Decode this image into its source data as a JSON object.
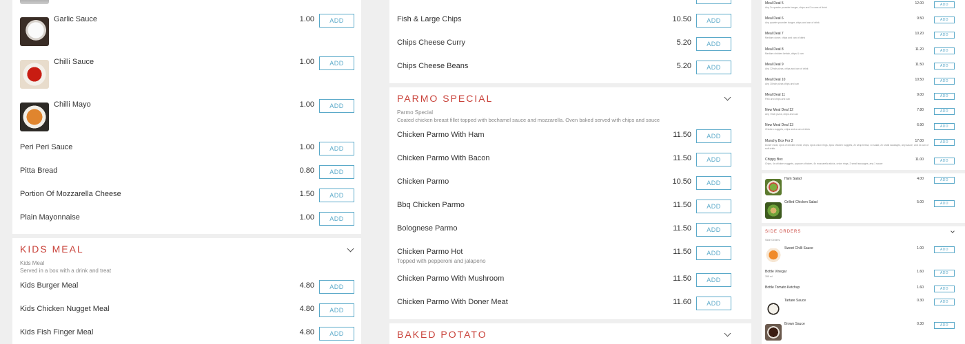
{
  "colors": {
    "accent": "#c9423a",
    "button": "#5aa9c9"
  },
  "add_label": "ADD",
  "col1": {
    "items": [
      {
        "name": "Garlic Sauce",
        "price": "1.00",
        "image": "garlic-sauce"
      },
      {
        "name": "Chilli Sauce",
        "price": "1.00",
        "image": "chilli-sauce"
      },
      {
        "name": "Chilli Mayo",
        "price": "1.00",
        "image": "chilli-mayo"
      },
      {
        "name": "Peri Peri Sauce",
        "price": "1.00"
      },
      {
        "name": "Pitta Bread",
        "price": "0.80"
      },
      {
        "name": "Portion Of Mozzarella Cheese",
        "price": "1.50"
      },
      {
        "name": "Plain Mayonnaise",
        "price": "1.00"
      }
    ],
    "kids": {
      "title": "KIDS MEAL",
      "sub_title": "Kids Meal",
      "sub_desc": "Served in a box with a drink and treat",
      "items": [
        {
          "name": "Kids Burger Meal",
          "price": "4.80"
        },
        {
          "name": "Kids Chicken Nugget Meal",
          "price": "4.80"
        },
        {
          "name": "Kids Fish Finger Meal",
          "price": "4.80"
        }
      ]
    }
  },
  "col2": {
    "items": [
      {
        "name": "Fish & Large Chips",
        "price": "10.50"
      },
      {
        "name": "Chips Cheese Curry",
        "price": "5.20"
      },
      {
        "name": "Chips Cheese Beans",
        "price": "5.20"
      }
    ],
    "parmo": {
      "title": "PARMO SPECIAL",
      "sub_title": "Parmo Special",
      "sub_desc": "Coated chicken breast fillet topped with bechamel sauce and mozzarella. Oven baked served with chips and sauce",
      "items": [
        {
          "name": "Chicken Parmo With Ham",
          "price": "11.50"
        },
        {
          "name": "Chicken Parmo With Bacon",
          "price": "11.50"
        },
        {
          "name": "Chicken Parmo",
          "price": "10.50"
        },
        {
          "name": "Bbq Chicken Parmo",
          "price": "11.50"
        },
        {
          "name": "Bolognese Parmo",
          "price": "11.50"
        },
        {
          "name": "Chicken Parmo Hot",
          "price": "11.50",
          "desc": "Topped with pepperoni and jalapeno"
        },
        {
          "name": "Chicken Parmo With Mushroom",
          "price": "11.50"
        },
        {
          "name": "Chicken Parmo With Doner Meat",
          "price": "11.60"
        }
      ]
    },
    "baked": {
      "title": "BAKED POTATO"
    }
  },
  "col3": {
    "deals": [
      {
        "name": "Meal Deal 5",
        "price": "12.00",
        "desc": "Any 2x quarter pounder burger, chips and 2x cans of drink"
      },
      {
        "name": "Meal Deal 6",
        "price": "9.50",
        "desc": "Any quarter pounder burger, chips and can of drink"
      },
      {
        "name": "Meal Deal 7",
        "price": "10.20",
        "desc": "Medium doner, chips and can of drink"
      },
      {
        "name": "Meal Deal 8",
        "price": "11.20",
        "desc": "Medium chicken kebab, chips & can"
      },
      {
        "name": "Meal Deal 9",
        "price": "11.50",
        "desc": "Any 12inch pizza, chips and can of drink"
      },
      {
        "name": "Meal Deal 10",
        "price": "10.50",
        "desc": "Any 10inch pizza chips and can"
      },
      {
        "name": "Meal Deal 11",
        "price": "9.00",
        "desc": "Fish and chips and can"
      },
      {
        "name": "New Meal Deal 12",
        "price": "7.80",
        "desc": "Any 7inch pizza, chips and can"
      },
      {
        "name": "New Meal Deal 13",
        "price": "6.90",
        "desc": "Chicken nuggets, chips and a can of drink"
      },
      {
        "name": "Munchy Box For 2",
        "price": "17.00",
        "desc": "Doner meat, 2pcs of chicken meat, chips, 4pcs onion rings, 4pcs chicken nuggets, 2x wrap bread, 1x salad, 2x small sausages, any sauce, and 2x can of soft drink."
      },
      {
        "name": "Chippy Box",
        "price": "11.00",
        "desc": "Chips, 4x chicken nuggets, popcorn chicken, 4x mozzarella sticks, onion rings, 2 small sausages, any 1 sauce"
      }
    ],
    "salads": [
      {
        "name": "Ham Salad",
        "price": "4.00"
      },
      {
        "name": "Grilled Chicken Salad",
        "price": "5.00"
      }
    ],
    "side": {
      "title": "SIDE ORDERS",
      "sub_title": "Side Orders",
      "items": [
        {
          "name": "Sweet Chilli Sauce",
          "price": "1.00",
          "image": "sweet-chilli"
        },
        {
          "name": "Bottle Vinegar",
          "price": "1.60",
          "desc": "355 ml"
        },
        {
          "name": "Bottle Tomato Ketchup",
          "price": "1.60"
        },
        {
          "name": "Tartare Sauce",
          "price": "0.30",
          "image": "tartare"
        },
        {
          "name": "Brown Sauce",
          "price": "0.30",
          "image": "brown-sauce"
        }
      ]
    }
  }
}
